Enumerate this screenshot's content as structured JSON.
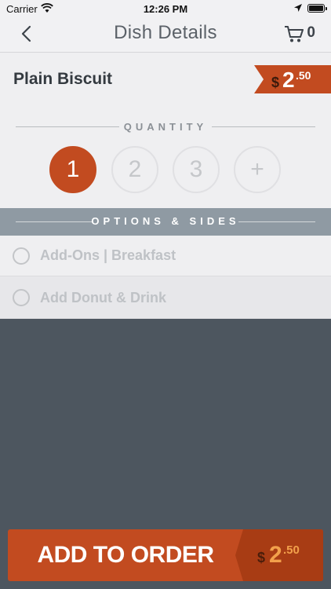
{
  "status_bar": {
    "carrier": "Carrier",
    "time": "12:26 PM"
  },
  "nav": {
    "title": "Dish Details",
    "cart_count": "0"
  },
  "dish": {
    "name": "Plain Biscuit",
    "price": {
      "currency": "$",
      "dollars": "2",
      "cents": ".50"
    }
  },
  "quantity": {
    "label": "QUANTITY",
    "options": [
      "1",
      "2",
      "3",
      "+"
    ],
    "selected": "1"
  },
  "options": {
    "label": "OPTIONS & SIDES",
    "items": [
      {
        "label": "Add-Ons | Breakfast",
        "selected": false
      },
      {
        "label": "Add Donut & Drink",
        "selected": false
      }
    ]
  },
  "add_to_order": {
    "label": "ADD TO ORDER",
    "price": {
      "currency": "$",
      "dollars": "2",
      "cents": ".50"
    }
  },
  "colors": {
    "accent": "#c24b20",
    "accent_dark": "#a83c14",
    "background": "#4d565f",
    "section_header": "#8f9aa3"
  }
}
